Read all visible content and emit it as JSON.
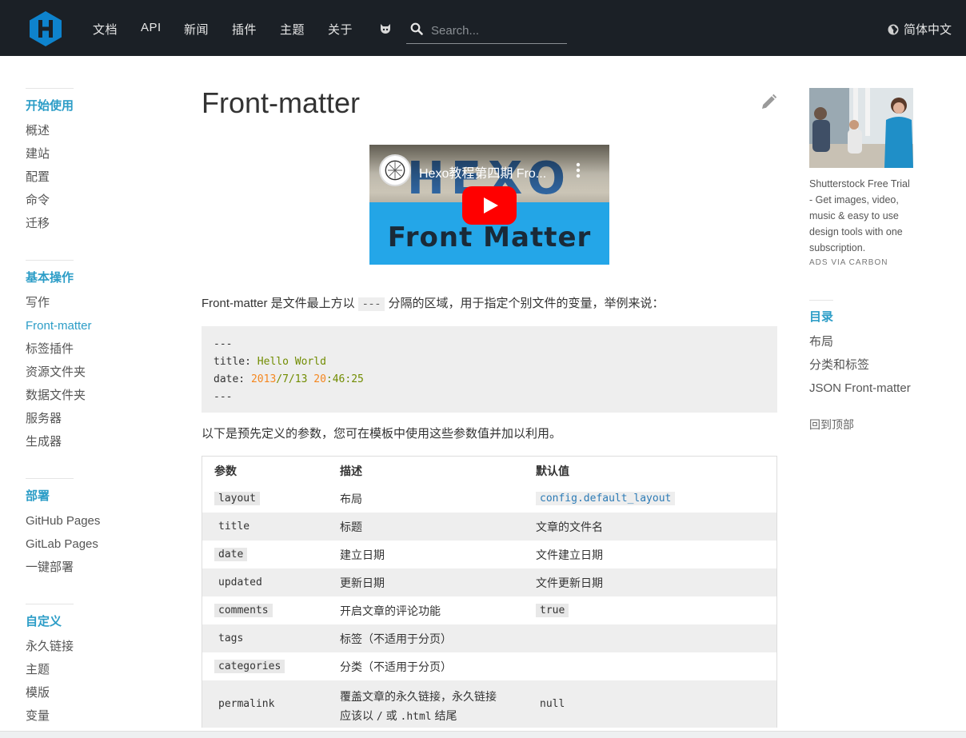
{
  "header": {
    "nav": [
      "文档",
      "API",
      "新闻",
      "插件",
      "主题",
      "关于"
    ],
    "search_placeholder": "Search...",
    "language": "简体中文"
  },
  "sidebar": {
    "sections": [
      {
        "title": "开始使用",
        "items": [
          "概述",
          "建站",
          "配置",
          "命令",
          "迁移"
        ]
      },
      {
        "title": "基本操作",
        "items": [
          "写作",
          "Front-matter",
          "标签插件",
          "资源文件夹",
          "数据文件夹",
          "服务器",
          "生成器"
        ],
        "active": "Front-matter"
      },
      {
        "title": "部署",
        "items": [
          "GitHub Pages",
          "GitLab Pages",
          "一键部署"
        ]
      },
      {
        "title": "自定义",
        "items": [
          "永久链接",
          "主题",
          "模版",
          "变量"
        ]
      }
    ]
  },
  "main": {
    "title": "Front-matter",
    "video_title": "Hexo教程第四期 Fro...",
    "video_thumb_top": "HEXO",
    "video_thumb_bottom": "Front Matter",
    "intro_before": "Front-matter 是文件最上方以",
    "intro_code": "---",
    "intro_after": "分隔的区域，用于指定个别文件的变量，举例来说：",
    "code": {
      "line1": "---",
      "title_key": "title: ",
      "title_val": "Hello World",
      "date_key": "date: ",
      "date_y": "2013",
      "date_md": "/7/13 ",
      "date_h": "20",
      "date_rest": ":46:25",
      "line4": "---"
    },
    "params_intro": "以下是预先定义的参数，您可在模板中使用这些参数值并加以利用。",
    "table": {
      "headers": [
        "参数",
        "描述",
        "默认值"
      ],
      "rows": [
        {
          "param": "layout",
          "desc": "布局",
          "default": "config.default_layout",
          "default_type": "link"
        },
        {
          "param": "title",
          "desc": "标题",
          "default": "文章的文件名",
          "default_type": "text"
        },
        {
          "param": "date",
          "desc": "建立日期",
          "default": "文件建立日期",
          "default_type": "text"
        },
        {
          "param": "updated",
          "desc": "更新日期",
          "default": "文件更新日期",
          "default_type": "text"
        },
        {
          "param": "comments",
          "desc": "开启文章的评论功能",
          "default": "true",
          "default_type": "code"
        },
        {
          "param": "tags",
          "desc": "标签（不适用于分页）",
          "default": "",
          "default_type": "text"
        },
        {
          "param": "categories",
          "desc": "分类（不适用于分页）",
          "default": "",
          "default_type": "text"
        }
      ],
      "permalink": {
        "param": "permalink",
        "desc_line1": "覆盖文章的永久链接，永久链接",
        "desc_line2_a": "应该以",
        "desc_line2_slash": "/",
        "desc_line2_or": "或",
        "desc_line2_html": ".html",
        "desc_line2_end": "结尾",
        "default": "null"
      }
    }
  },
  "right": {
    "ad_text": "Shutterstock Free Trial - Get images, video, music & easy to use design tools with one subscription.",
    "ad_via": "ADS VIA CARBON",
    "toc_title": "目录",
    "toc_items": [
      "布局",
      "分类和标签",
      "JSON Front-matter"
    ],
    "back_to_top": "回到顶部"
  },
  "colors": {
    "header_bg": "#1b2026",
    "accent": "#2c9dc7",
    "logo": "#0e83cd",
    "code_bg": "#eeeeee"
  }
}
